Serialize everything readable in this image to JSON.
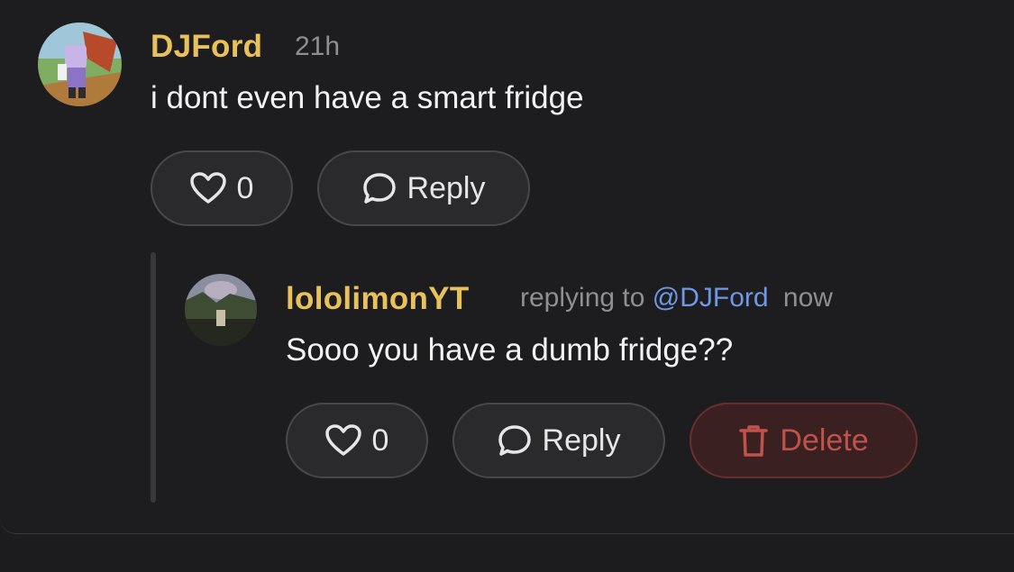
{
  "comment": {
    "username": "DJFord",
    "time": "21h",
    "text": "i dont even have a smart fridge",
    "like_count": "0",
    "reply_label": "Reply"
  },
  "reply": {
    "username": "lololimonYT",
    "replying_prefix": "replying to",
    "mention": "@DJFord",
    "time": "now",
    "text": "Sooo you have a dumb fridge??",
    "like_count": "0",
    "reply_label": "Reply",
    "delete_label": "Delete"
  },
  "colors": {
    "background": "#1d1d1f",
    "username": "#e8c15b",
    "mention": "#6e98e6",
    "muted": "#8e8e93",
    "delete": "#c0524c"
  },
  "icons": {
    "like": "heart-icon",
    "reply": "speech-bubble-icon",
    "delete": "trash-icon"
  }
}
